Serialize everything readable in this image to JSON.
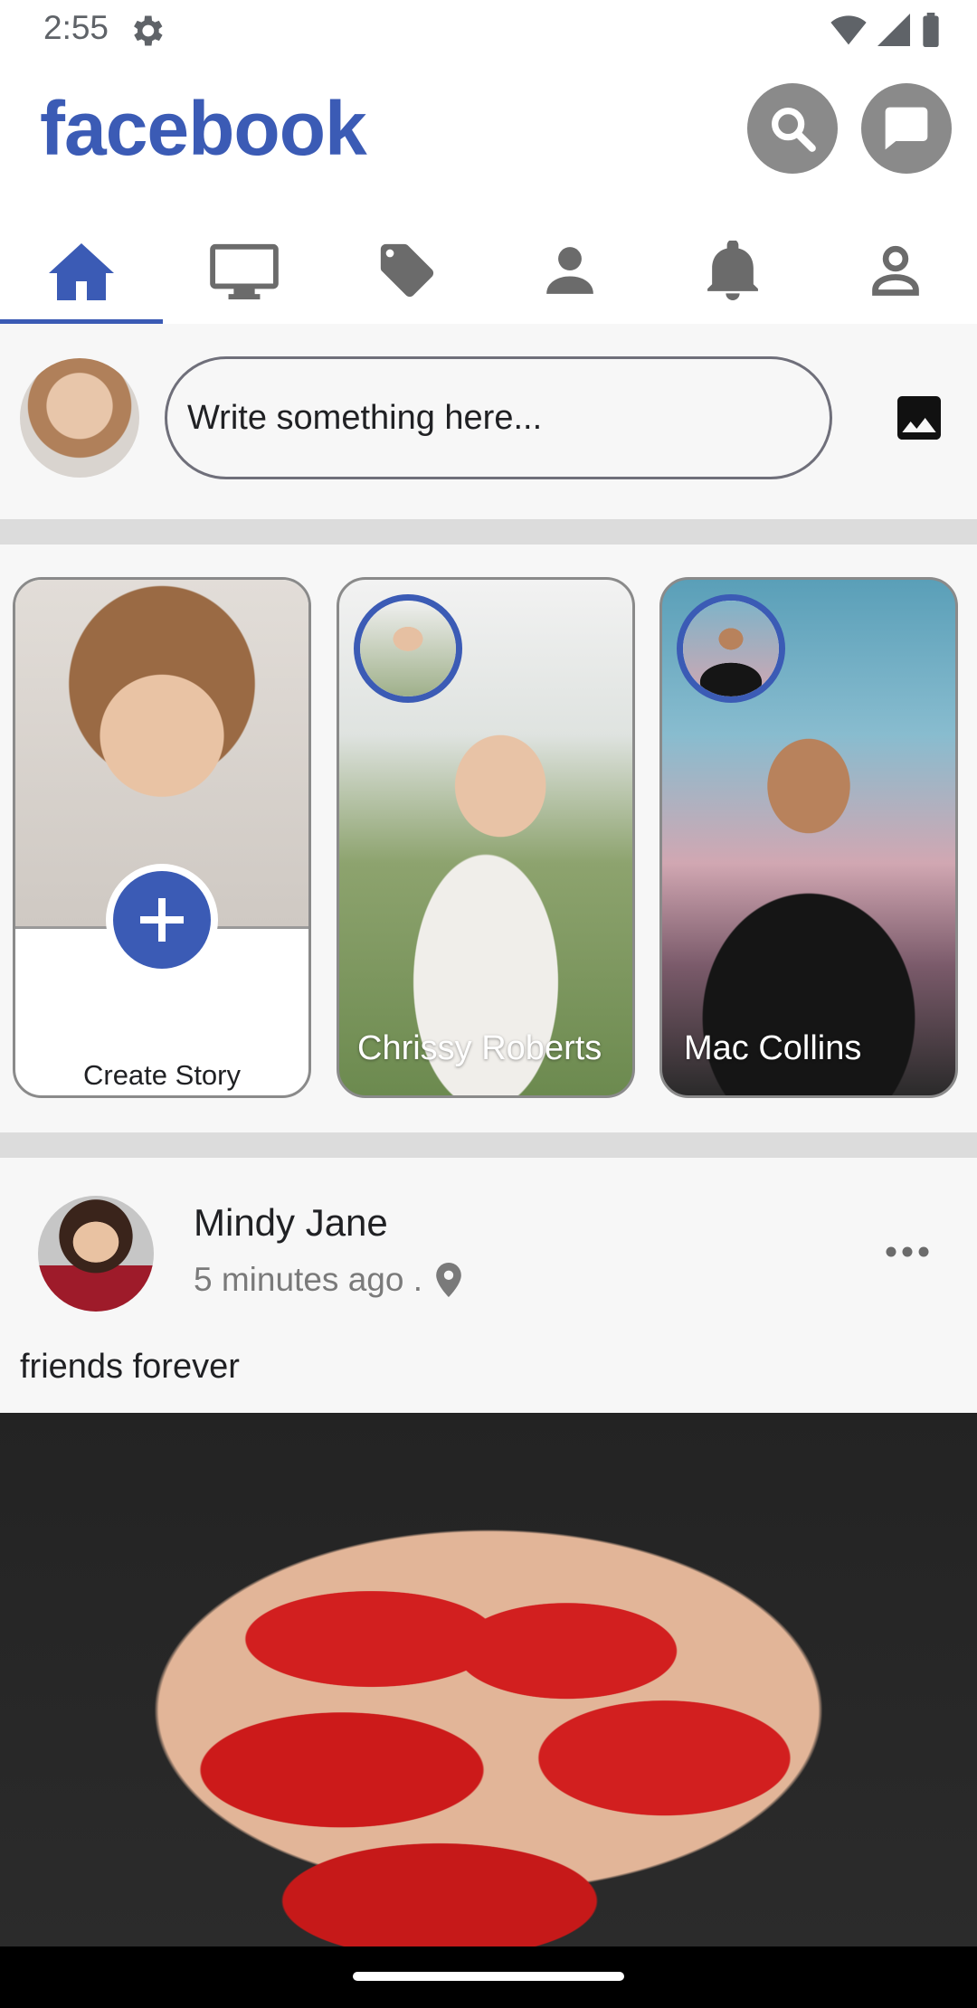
{
  "status_bar": {
    "time": "2:55"
  },
  "header": {
    "brand": "facebook",
    "accent_color": "#3b5bb5"
  },
  "tabs": [
    {
      "icon": "home-icon",
      "active": true
    },
    {
      "icon": "tv-icon",
      "active": false
    },
    {
      "icon": "tag-icon",
      "active": false
    },
    {
      "icon": "person-icon",
      "active": false
    },
    {
      "icon": "bell-icon",
      "active": false
    },
    {
      "icon": "profile-outline-icon",
      "active": false
    }
  ],
  "composer": {
    "placeholder": "Write something here..."
  },
  "stories": {
    "create_label": "Create Story",
    "items": [
      {
        "name": "Chrissy Roberts"
      },
      {
        "name": "Mac Collins"
      }
    ]
  },
  "post": {
    "author": "Mindy Jane",
    "time": "5 minutes ago .",
    "text": "friends forever"
  }
}
